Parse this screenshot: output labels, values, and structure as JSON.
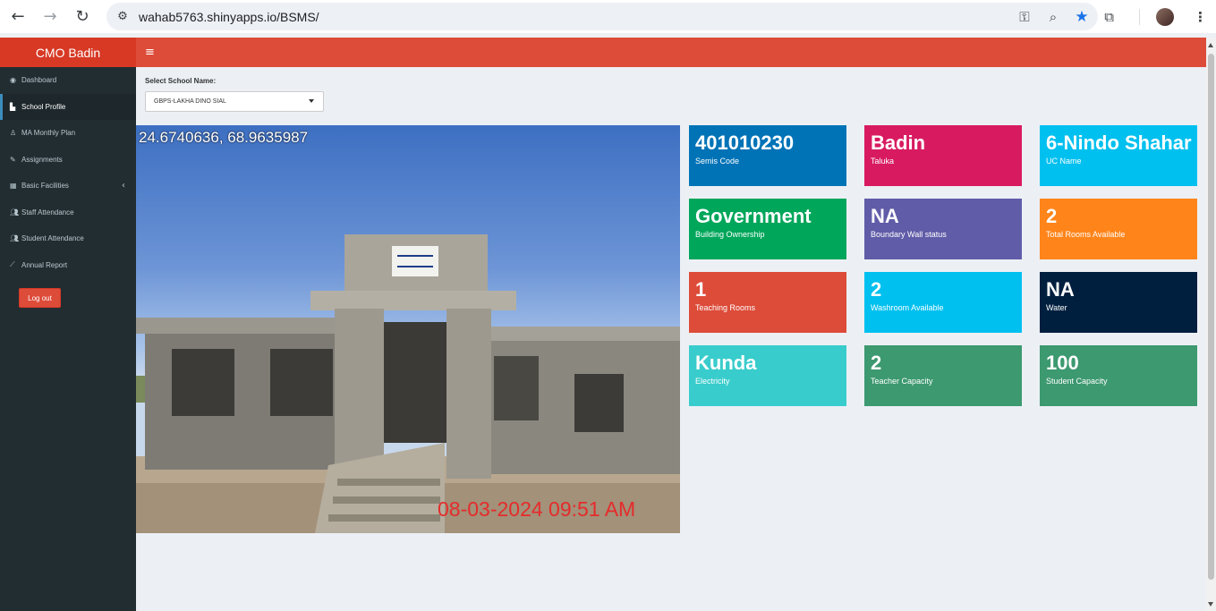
{
  "browser": {
    "url": "wahab5763.shinyapps.io/BSMS/",
    "icons": [
      "back-arrow-icon",
      "forward-arrow-icon",
      "reload-icon",
      "site-info-icon",
      "password-key-icon",
      "zoom-icon",
      "bookmark-star-icon",
      "extensions-icon",
      "profile-avatar",
      "more-menu-icon"
    ]
  },
  "app": {
    "logo": "CMO Badin",
    "sidebar": [
      {
        "label": "Dashboard",
        "icon": "dashboard-icon"
      },
      {
        "label": "School Profile",
        "icon": "school-icon"
      },
      {
        "label": "MA Monthly Plan",
        "icon": "user-icon"
      },
      {
        "label": "Assignments",
        "icon": "pencil-icon"
      },
      {
        "label": "Basic Facilities",
        "icon": "table-icon"
      },
      {
        "label": "Staff Attendance",
        "icon": "users-icon"
      },
      {
        "label": "Student Attendance",
        "icon": "users-icon"
      },
      {
        "label": "Annual Report",
        "icon": "line-chart-icon"
      }
    ],
    "logout_label": "Log out",
    "select": {
      "label": "Select School Name:",
      "value": "GBPS-LAKHA DINO SIAL"
    },
    "photo": {
      "gps": "24.6740636, 68.9635987",
      "timestamp": "08-03-2024 09:51 AM"
    },
    "boxes": [
      {
        "value": "401010230",
        "label": "Semis Code",
        "color": "#0073b7"
      },
      {
        "value": "Badin",
        "label": "Taluka",
        "color": "#d81b60"
      },
      {
        "value": "6-Nindo Shahar",
        "label": "UC Name",
        "color": "#00c0ef"
      },
      {
        "value": "Government",
        "label": "Building Ownership",
        "color": "#00a65a"
      },
      {
        "value": "NA",
        "label": "Boundary Wall status",
        "color": "#605ca8"
      },
      {
        "value": "2",
        "label": "Total Rooms Available",
        "color": "#ff851b"
      },
      {
        "value": "1",
        "label": "Teaching Rooms",
        "color": "#dd4b39"
      },
      {
        "value": "2",
        "label": "Washroom Available",
        "color": "#00c0ef"
      },
      {
        "value": "NA",
        "label": "Water",
        "color": "#001f3f"
      },
      {
        "value": "Kunda",
        "label": "Electricity",
        "color": "#39cccc"
      },
      {
        "value": "2",
        "label": "Teacher Capacity",
        "color": "#3d9970"
      },
      {
        "value": "100",
        "label": "Student Capacity",
        "color": "#3d9970"
      }
    ]
  }
}
